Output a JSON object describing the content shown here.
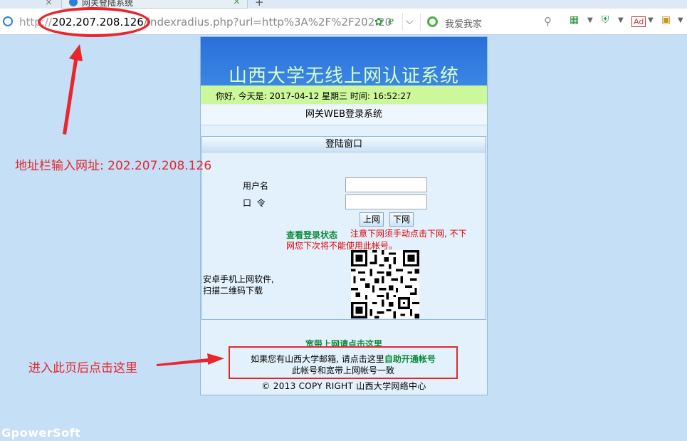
{
  "browser": {
    "prev_tab_close": "×",
    "active_tab_title": "网关登陆系统",
    "active_tab_close": "×",
    "new_tab": "+",
    "url_protocol": "http://",
    "url_host": "202.207.208.126",
    "url_path": "/indexradius.php?url=http%3A%2F%2F202.20",
    "search_placeholder": "我爱我家",
    "icons": [
      "globe-icon",
      "sync-icon",
      "ie-icon",
      "chevron-down-icon",
      "search-logo-icon",
      "magnifier-icon",
      "apps-grid-icon",
      "shield-icon",
      "adblock-icon",
      "toolbox-icon"
    ],
    "accent_color": "#2a7fd6"
  },
  "page": {
    "banner_title": "山西大学无线上网认证系统",
    "greeting": "你好, 今天是: 2017-04-12 星期三 时间: 16:52:27",
    "gateway_title": "网关WEB登录系统",
    "login_window_title": "登陆窗口",
    "username_label": "用户名",
    "password_label": "口  令",
    "login_button": "上网",
    "logout_button": "下网",
    "status_link": "查看登录状态",
    "warning_line1": "注意下网须手动点击下网, 不下",
    "warning_line2": "网您下次将不能使用此帐号。",
    "app_line1": "安卓手机上网软件,",
    "app_line2": "扫描二维码下载",
    "broadband_link": "宽带上网请点击这里",
    "email_prefix": "如果您有山西大学邮箱, 请点击这里",
    "email_link": "自助开通帐号",
    "email_line2": "此帐号和宽带上网帐号一致",
    "copyright": "© 2013 COPY RIGHT 山西大学网络中心",
    "banner_color": "#2f7ae0",
    "greeting_bg": "#ccf79a"
  },
  "annotations": {
    "url_note": "地址栏输入网址: 202.207.208.126",
    "enter_note": "进入此页后点击这里",
    "color": "#e8262c"
  },
  "watermark": "GpowerSoft"
}
